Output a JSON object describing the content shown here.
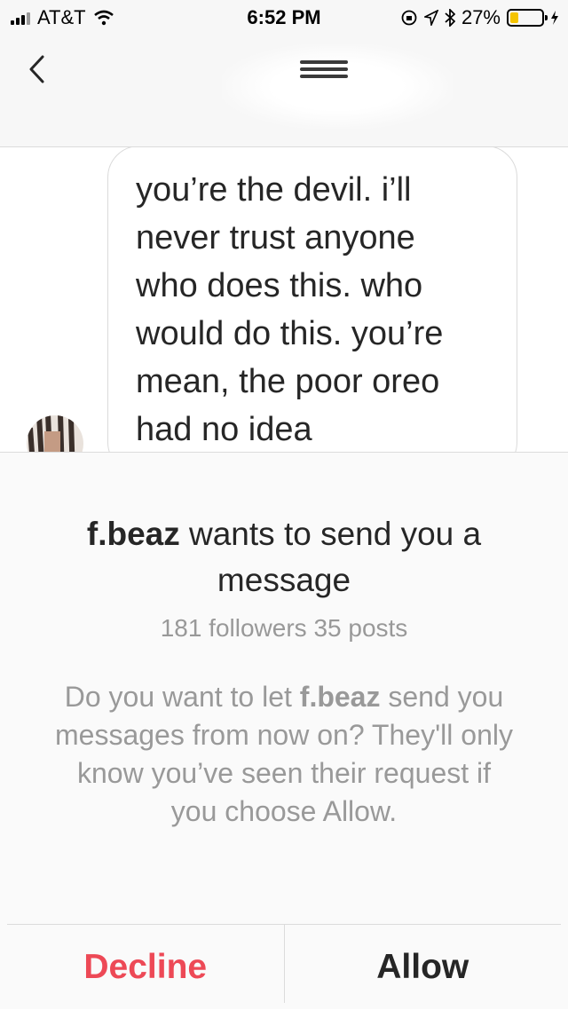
{
  "status_bar": {
    "carrier": "AT&T",
    "time": "6:52 PM",
    "battery_percent": "27%",
    "battery_level": 0.27,
    "battery_color": "#f5c400"
  },
  "header": {
    "back_icon": "chevron-left-icon"
  },
  "message": {
    "lines": [
      "you’re the devil. i’ll",
      "never trust anyone",
      "who does this. who",
      "would do this. you’re",
      "mean, the poor oreo",
      "had no idea"
    ]
  },
  "request": {
    "username": "f.beaz",
    "headline_rest": " wants to send you a message",
    "stats": "181 followers 35 posts",
    "explain_prefix": "Do you want to let ",
    "explain_username": "f.beaz",
    "explain_suffix": " send you messages from now on? They'll only know you’ve seen their request if you choose Allow."
  },
  "actions": {
    "decline_label": "Decline",
    "allow_label": "Allow"
  },
  "colors": {
    "decline": "#ed4956",
    "secondary_text": "#999999",
    "divider": "#dbdbdb"
  }
}
